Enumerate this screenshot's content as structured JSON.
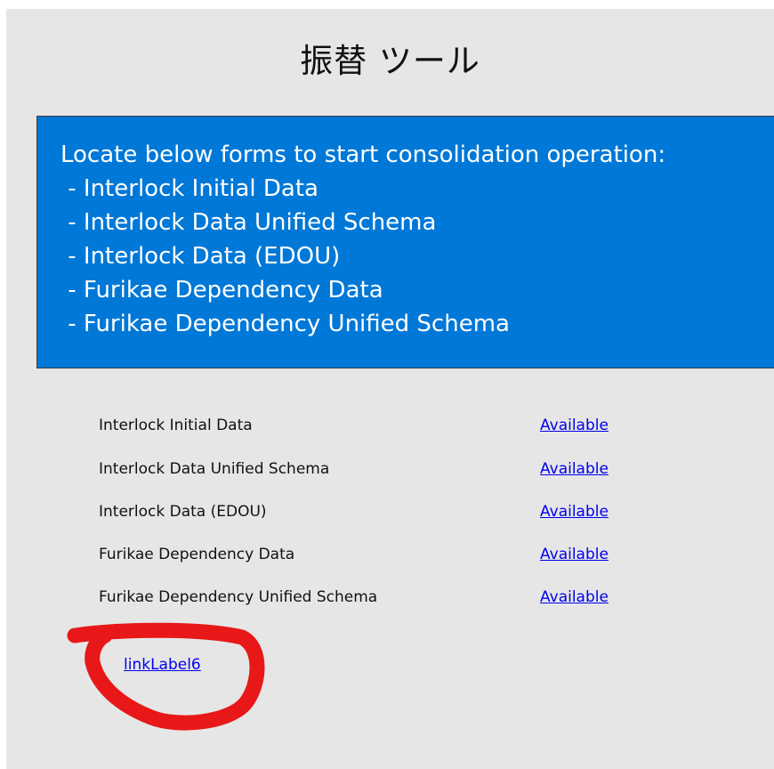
{
  "window": {
    "title": "振替 ツール"
  },
  "info_panel": {
    "text": "Locate below forms to start consolidation operation:\n - Interlock Initial Data\n - Interlock Data Unified Schema\n - Interlock Data (EDOU)\n - Furikae Dependency Data\n - Furikae Dependency Unified Schema",
    "background_color": "#0078d7",
    "text_color": "#ffffff"
  },
  "forms": [
    {
      "label": "Interlock Initial Data",
      "status": "Available"
    },
    {
      "label": "Interlock Data Unified Schema",
      "status": "Available"
    },
    {
      "label": "Interlock Data (EDOU)",
      "status": "Available"
    },
    {
      "label": "Furikae Dependency Data",
      "status": "Available"
    },
    {
      "label": "Furikae Dependency Unified Schema",
      "status": "Available"
    }
  ],
  "extra_link": {
    "label": "linkLabel6"
  },
  "colors": {
    "window_background": "#e6e6e6",
    "link": "#0000ee",
    "annotation": "#e81818"
  }
}
